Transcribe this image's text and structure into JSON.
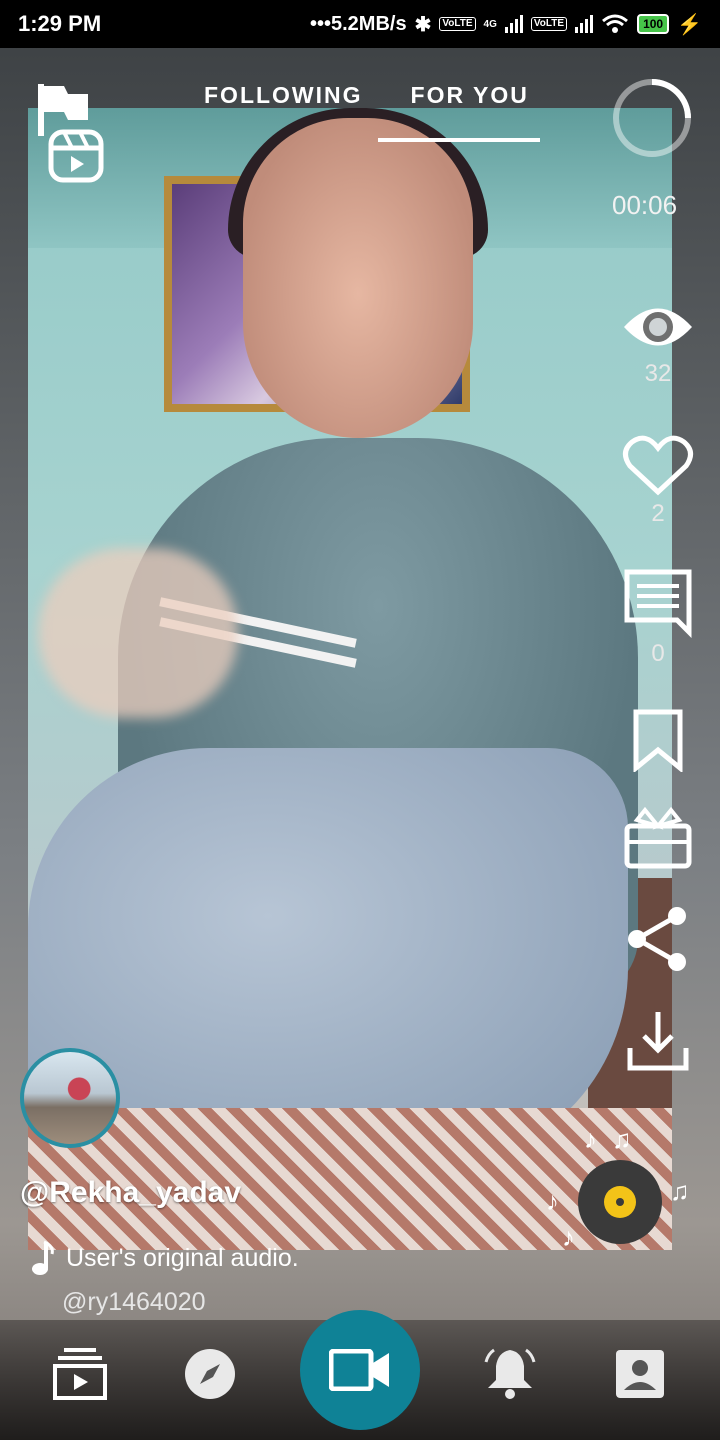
{
  "status_bar": {
    "time": "1:29 PM",
    "speed": "•••5.2MB/s",
    "network": "4G",
    "battery": "100"
  },
  "tabs": [
    {
      "label": "FOLLOWING",
      "active": false
    },
    {
      "label": "FOR YOU",
      "active": true
    }
  ],
  "timer": "00:06",
  "stats": {
    "views": "32",
    "likes": "2",
    "comments": "0"
  },
  "post": {
    "username": "@Rekha_yadav",
    "audio": "User's original audio.",
    "audio_user": "@ry1464020"
  },
  "icons": {
    "top_left": [
      "flag-icon",
      "reels-icon"
    ],
    "side": [
      "eye-icon",
      "heart-icon",
      "comment-icon",
      "bookmark-icon",
      "gift-icon",
      "share-icon",
      "download-icon"
    ],
    "nav": [
      "feed-icon",
      "compass-icon",
      "video-camera-icon",
      "bell-icon",
      "profile-icon"
    ]
  },
  "colors": {
    "accent": "#0f8296",
    "avatar_ring": "#2a8fa3",
    "disc_center": "#f3c318"
  }
}
